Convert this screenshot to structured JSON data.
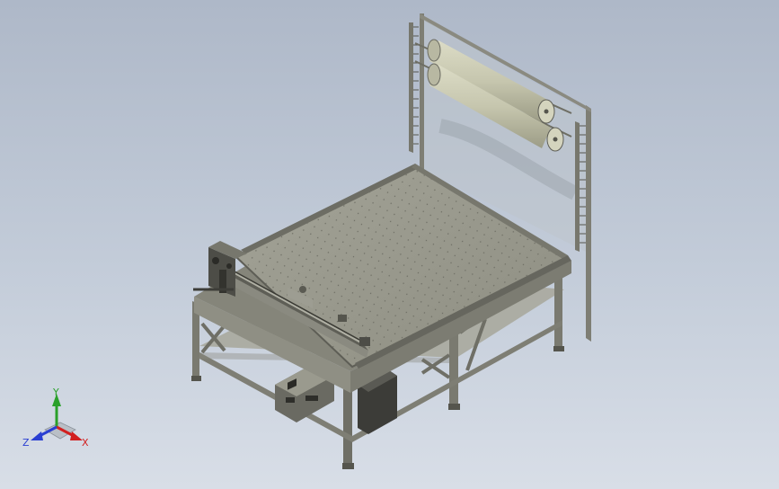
{
  "triad": {
    "x_label": "X",
    "y_label": "Y",
    "z_label": "Z"
  },
  "colors": {
    "background_top": "#aeb8c8",
    "background_bottom": "#d8dee7",
    "metal": "#8a8a80",
    "table_top": "#9a9a8e",
    "roller": "#c8c8b2",
    "axis_x": "#d22020",
    "axis_y": "#2aa02a",
    "axis_z": "#2a3fd2"
  }
}
